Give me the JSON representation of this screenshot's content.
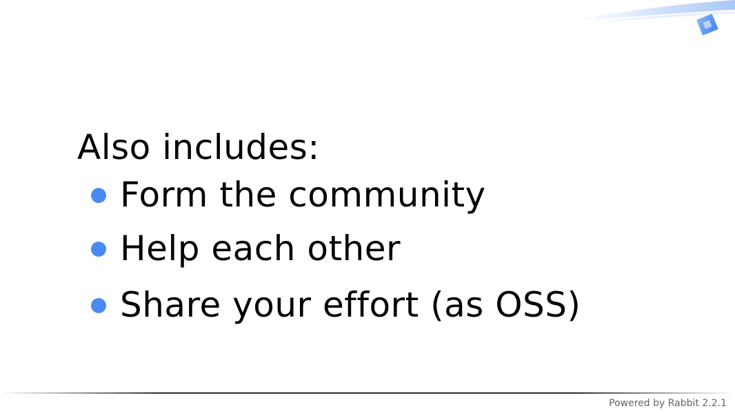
{
  "slide": {
    "heading": "Also includes:",
    "bullets": [
      "Form the community",
      "Help each other",
      "Share your effort (as OSS)"
    ],
    "footer_text": "Powered by Rabbit 2.2.1"
  },
  "colors": {
    "bullet": "#4a8af4",
    "text": "#000000",
    "footer_text": "#666666",
    "decoration": "#3f7fe8"
  },
  "icons": {
    "corner": "rabbit-theme-corner-decoration"
  }
}
